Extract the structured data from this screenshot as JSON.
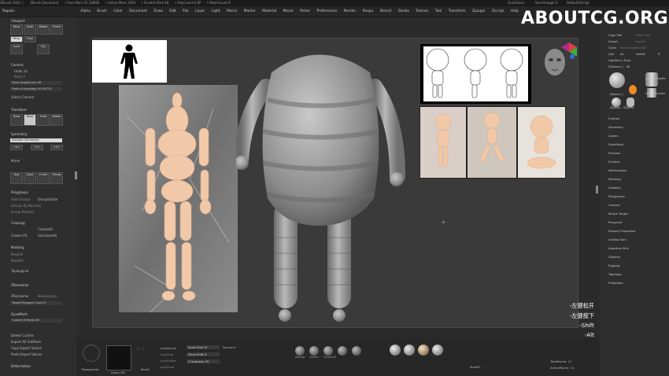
{
  "window": {
    "title_items": [
      "ZBrush 2020 ⓘ",
      "ZBrush Document",
      "• Free Mem 25.138GB",
      "• Active Mem 1264",
      "• Scratch Disk 48",
      "• PolyCount 6 KP",
      "• MeshCount 9"
    ],
    "right_items": [
      "QuickSave",
      "See-through 0",
      "Default2Script"
    ]
  },
  "menu": {
    "left_label": "Rapatu",
    "items": [
      "Alpha",
      "Brush",
      "Color",
      "Document",
      "Draw",
      "Edit",
      "File",
      "Layer",
      "Light",
      "Macro",
      "Marker",
      "Material",
      "Movie",
      "Picker",
      "Preferences",
      "Render",
      "Raspu",
      "Stencil",
      "Stroke",
      "Texture",
      "Tool",
      "Transform",
      "Zplugin",
      "Zscript",
      "Help"
    ]
  },
  "left_panel": {
    "sections": {
      "viewport": "Viewport",
      "camera": "Camera",
      "transform": "Transform",
      "symmetry": "Symmetry",
      "mirror": "Mirror",
      "polygroups": "Polygroups",
      "creasing": "Creasing",
      "masking": "Masking",
      "zremesher": "ZRemesher",
      "dynamesh": "DynaMesh",
      "deformation": "Deformation"
    },
    "viewport_buttons": [
      "Move",
      "Scale",
      "Rotate",
      "Frame",
      "Persp",
      "Floor",
      "Local",
      "Xyz"
    ],
    "camera_items": [
      "Undo 14",
      "Redo 0",
      "Focal length(mm) 50",
      "Field of view(deg) 39.59775",
      "Select Camera"
    ],
    "transform_buttons": [
      "Draw",
      "Move",
      "Scale",
      "Rotate"
    ],
    "symmetry_items": [
      "Activate Symmetry",
      ">X<",
      ">Y<",
      ">Z<"
    ],
    "mirror_label": "Mirror",
    "solo_buttons": [
      "Solo",
      "Qube",
      "X Sym",
      "Transp"
    ],
    "polygroup_items": [
      "Auto Groups",
      "GroupVisible",
      "Groups By Normals",
      "Group Masked"
    ],
    "creasing_items": [
      "CreaseAll",
      "Crease PG",
      "UnCreaseAll"
    ],
    "masking_items": [
      "MaskAll",
      "MaskPG",
      "Topological"
    ],
    "zremesher_items": [
      "ZRemesher",
      "KeepGroups",
      "Target Polygons Count 5"
    ],
    "dynamesh_items": [
      "DynaMesh",
      "Custom 6 Points 30"
    ],
    "tail_items": [
      "Delete Caches",
      "Export All SubTools",
      "Copy Export Values",
      "Paste Export Values"
    ]
  },
  "right_panel": {
    "tool_items": [
      "Copy Tool",
      "Paste Tool",
      "Import",
      "Export",
      "Clone",
      "Make PolyMesh3D",
      "GoZ",
      "All",
      "Visible",
      "R",
      "Lightbox ▸ Tools",
      "ZSphere_1 · 46"
    ],
    "thumb_labels": [
      "ZSphere_1",
      "Cylinder PolyMe",
      "Cylinder",
      "Simple Cylinder",
      "ZSphere",
      "ZSphere"
    ],
    "menu_items": [
      "Subtool",
      "Geometry",
      "Layers",
      "FiberMesh",
      "Preview",
      "Surface",
      "Deformation",
      "Masking",
      "Visibility",
      "Polygroups",
      "Contact",
      "Morph Target",
      "Polypaint",
      "Display Properties",
      "Unified Skin",
      "Adaptive Skin",
      "ZSketch",
      "Rigging",
      "Topology",
      "Projection"
    ]
  },
  "bottom_bar": {
    "left_items": [
      "Transparent",
      "Alpha Off",
      "Brush"
    ],
    "lazy_items": [
      "LazyMouse",
      "LazyStep",
      "LazyRadius",
      "LazySnap"
    ],
    "draw_size": "Draw Size 21",
    "focal_shift": "Focal Shift 0",
    "intensity": "Z Intensity 25",
    "dynamic": "Dynamic",
    "materials": [
      "Matcap",
      "Gallery",
      "ClayBuild",
      "Skin Shade",
      "BasicMaterial",
      "Chrome",
      "BlinnDullerRegion"
    ],
    "presets": [
      "Wax",
      "Nape",
      "ExGet",
      "Spotted",
      "Flat",
      "Reflect"
    ],
    "counts": [
      "TotalPoints: 11",
      "ActivePoints: 11"
    ],
    "size_label": "SizeMT"
  },
  "watermark": "ABOUTCG.ORG",
  "key_hints": [
    "-左键松开",
    "-左键按下",
    "-Shift",
    "-Alt"
  ],
  "colors": {
    "background": "#2b2b2b",
    "panel": "#2e2e2e",
    "viewport": "#3a3a3a",
    "accent_orange": "#f08a24"
  }
}
